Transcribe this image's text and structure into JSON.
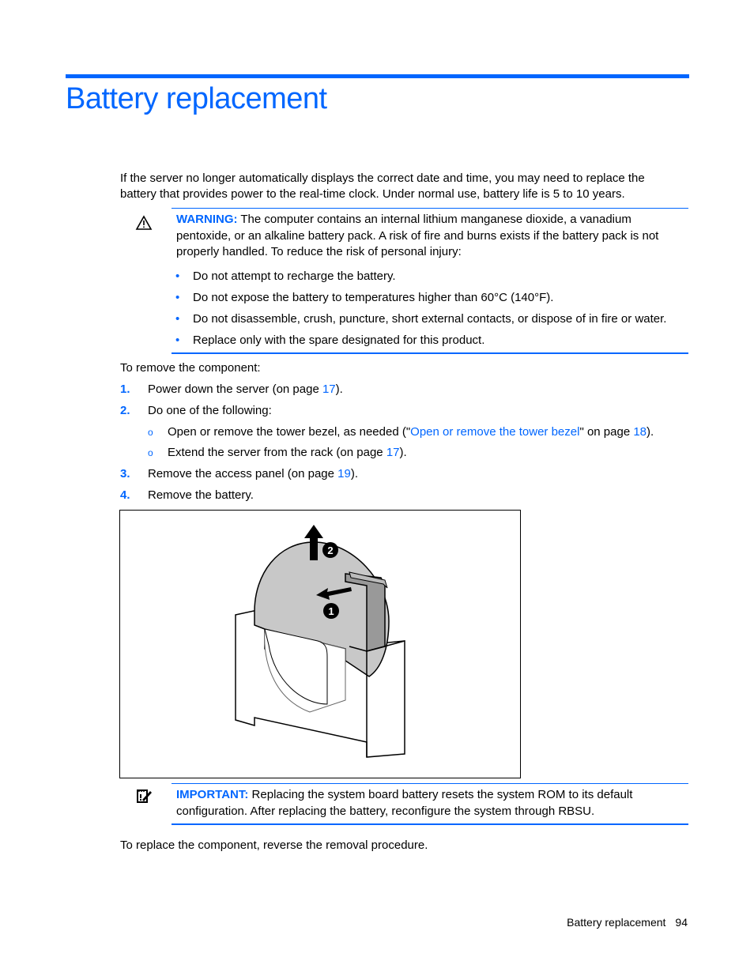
{
  "page": {
    "title": "Battery replacement",
    "intro": "If the server no longer automatically displays the correct date and time, you may need to replace the battery that provides power to the real-time clock. Under normal use, battery life is 5 to 10 years.",
    "warning": {
      "icon": "warning-triangle-icon",
      "label": "WARNING:",
      "text": " The computer contains an internal lithium manganese dioxide, a vanadium pentoxide, or an alkaline battery pack. A risk of fire and burns exists if the battery pack is not properly handled. To reduce the risk of personal injury:",
      "bullets": [
        "Do not attempt to recharge the battery.",
        "Do not expose the battery to temperatures higher than 60°C (140°F).",
        "Do not disassemble, crush, puncture, short external contacts, or dispose of in fire or water.",
        "Replace only with the spare designated for this product."
      ]
    },
    "remove_intro": "To remove the component:",
    "steps": [
      {
        "num": "1.",
        "pre": "Power down the server (on page ",
        "link": "17",
        "post": ")."
      },
      {
        "num": "2.",
        "pre": "Do one of the following:",
        "link": "",
        "post": ""
      },
      {
        "num": "3.",
        "pre": "Remove the access panel (on page ",
        "link": "19",
        "post": ")."
      },
      {
        "num": "4.",
        "pre": "Remove the battery.",
        "link": "",
        "post": ""
      }
    ],
    "substeps": [
      {
        "mark": "o",
        "pre": "Open or remove the tower bezel, as needed (\"",
        "link1": "Open or remove the tower bezel",
        "mid": "\" on page ",
        "link2": "18",
        "post": ")."
      },
      {
        "mark": "o",
        "pre": "Extend the server from the rack (on page ",
        "link1": "17",
        "post": ")."
      }
    ],
    "figure": {
      "callouts": [
        "1",
        "2"
      ]
    },
    "important": {
      "icon": "important-note-icon",
      "label": "IMPORTANT:",
      "text": " Replacing the system board battery resets the system ROM to its default configuration. After replacing the battery, reconfigure the system through RBSU."
    },
    "replace_text": "To replace the component, reverse the removal procedure.",
    "footer": {
      "section": "Battery replacement",
      "page_number": "94"
    }
  }
}
